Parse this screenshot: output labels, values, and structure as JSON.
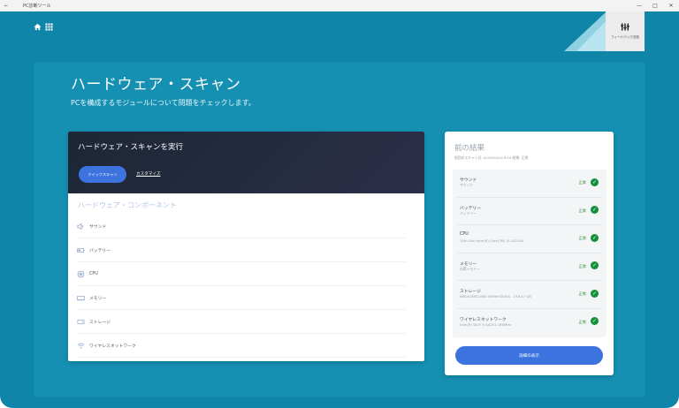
{
  "window": {
    "back_label": "←",
    "title": "PC診断ツール",
    "minimize": "—",
    "maximize": "□",
    "close": "✕"
  },
  "nav": {
    "home_icon": "home-icon",
    "apps_icon": "grid-icon"
  },
  "feedback": {
    "icon": "feedback-icon",
    "label": "フィードバック送信"
  },
  "page": {
    "title": "ハードウェア・スキャン",
    "subtitle": "PCを構成するモジュールについて問題をチェックします。"
  },
  "scan": {
    "title": "ハードウェア・スキャンを実行",
    "quick_scan_label": "クイックスキャン",
    "custom_label": "カスタマイズ",
    "section_label": "ハードウェア・コンポーネント",
    "components": [
      {
        "icon": "speaker-icon",
        "label": "サウンド"
      },
      {
        "icon": "battery-icon",
        "label": "バッテリー"
      },
      {
        "icon": "cpu-icon",
        "label": "CPU"
      },
      {
        "icon": "memory-icon",
        "label": "メモリー"
      },
      {
        "icon": "storage-icon",
        "label": "ストレージ"
      },
      {
        "icon": "wifi-icon",
        "label": "ワイヤレスネットワーク"
      }
    ]
  },
  "results": {
    "title": "前の結果",
    "meta": "前回のスキャン日: 2019/10/14 9:19 結果: 正常",
    "items": [
      {
        "name": "サウンド",
        "detail": "サウンド",
        "status": "正常"
      },
      {
        "name": "バッテリー",
        "detail": "バッテリー",
        "status": "正常"
      },
      {
        "name": "CPU",
        "detail": "10th Gen Intel(R) Core(TM) i5-10210U",
        "status": "正常"
      },
      {
        "name": "メモリー",
        "detail": "内蔵メモリー",
        "status": "正常"
      },
      {
        "name": "ストレージ",
        "detail": "KBG40ZNS256G NVMe KIOXIA - 238.47 GB",
        "status": "正常"
      },
      {
        "name": "ワイヤレスネットワーク",
        "detail": "Intel(R) Wi-Fi 6 AX201 160MHz",
        "status": "正常"
      }
    ],
    "details_button": "詳細の表示"
  },
  "colors": {
    "background": "#0f86a8",
    "panel": "#1590b2",
    "accent": "#3c73de",
    "ok": "#14903a"
  }
}
